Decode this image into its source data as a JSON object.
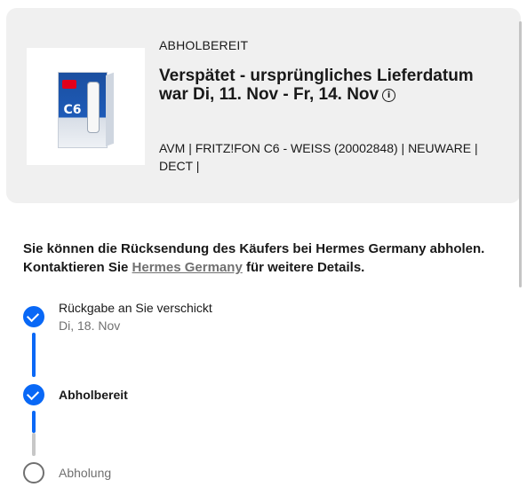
{
  "order_card": {
    "status_label": "ABHOLBEREIT",
    "title": "Verspätet - ursprüngliches Lieferdatum war Di, 11. Nov - Fr, 14. Nov",
    "info_icon": "info-icon",
    "product_desc": "AVM | FRITZ!FON C6 - WEISS (20002848) | NEUWARE | DECT |",
    "product_image": "FRITZ!Fon C6",
    "product_image_text": "C6"
  },
  "notice": {
    "text_before": "Sie können die Rücksendung des Käufers bei Hermes Germany abholen. Kontaktieren Sie ",
    "link_text": "Hermes Germany",
    "text_after": " für weitere Details."
  },
  "timeline": {
    "steps": [
      {
        "label": "Rückgabe an Sie verschickt",
        "date": "Di, 18. Nov",
        "state": "done"
      },
      {
        "label": "Abholbereit",
        "date": "",
        "state": "current"
      },
      {
        "label": "Abholung",
        "date": "",
        "state": "pending"
      }
    ]
  },
  "colors": {
    "accent": "#0968f6",
    "card_bg": "#f0f0f0",
    "muted_text": "#707070"
  }
}
